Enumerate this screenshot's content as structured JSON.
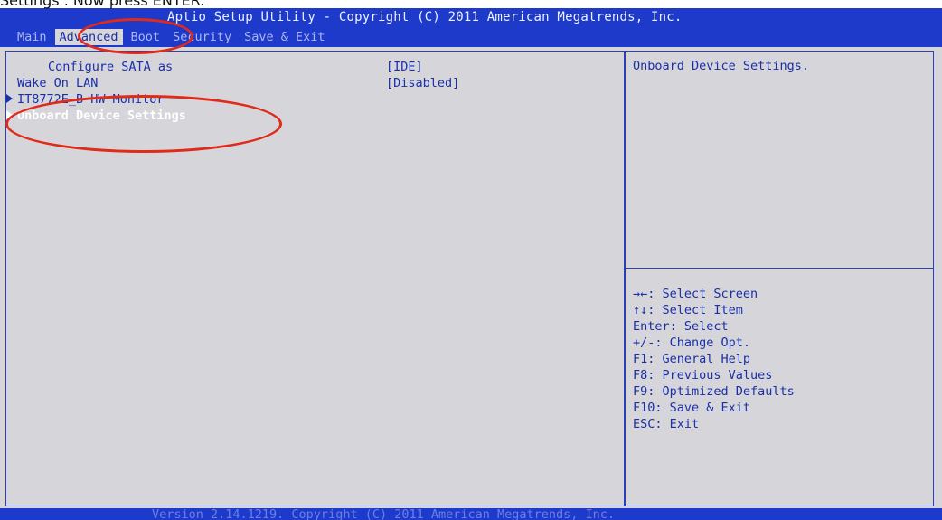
{
  "caption": "Settings . Now press ENTER.",
  "header": {
    "title": "Aptio Setup Utility - Copyright (C) 2011 American Megatrends, Inc.",
    "tabs": [
      {
        "label": "Main",
        "active": false
      },
      {
        "label": "Advanced",
        "active": true
      },
      {
        "label": "Boot",
        "active": false
      },
      {
        "label": "Security",
        "active": false
      },
      {
        "label": "Save & Exit",
        "active": false
      }
    ]
  },
  "menu": {
    "items": [
      {
        "label": "Configure SATA as",
        "value": "[IDE]",
        "submenu": false,
        "indent": true
      },
      {
        "label": "Wake On LAN",
        "value": "[Disabled]",
        "submenu": false,
        "indent": false
      },
      {
        "label": "IT8772E_B HW Monitor",
        "value": "",
        "submenu": true,
        "indent": false
      },
      {
        "label": "Onboard Device Settings",
        "value": "",
        "submenu": true,
        "indent": false,
        "selected": true
      }
    ]
  },
  "help": {
    "description": "Onboard Device Settings.",
    "keys": [
      "→←: Select Screen",
      "↑↓: Select Item",
      "Enter: Select",
      "+/-: Change Opt.",
      "F1: General Help",
      "F8: Previous Values",
      "F9: Optimized Defaults",
      "F10: Save & Exit",
      "ESC: Exit"
    ]
  },
  "footer": {
    "text": "Version 2.14.1219. Copyright (C) 2011 American Megatrends, Inc."
  },
  "colors": {
    "header_bg": "#1e3acb",
    "panel_bg": "#d6d6da",
    "text": "#1a2fa8",
    "annotation": "#e02a1a"
  }
}
